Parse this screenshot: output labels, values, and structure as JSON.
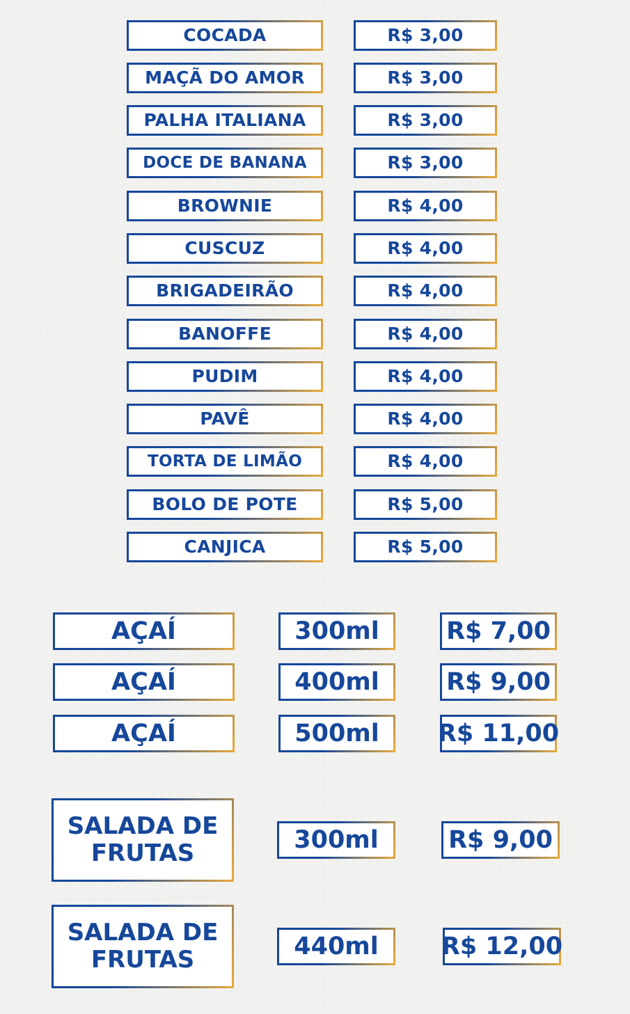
{
  "sweets": [
    {
      "name": "COCADA",
      "price": "R$ 3,00"
    },
    {
      "name": "MAÇÃ DO AMOR",
      "price": "R$ 3,00"
    },
    {
      "name": "PALHA ITALIANA",
      "price": "R$ 3,00"
    },
    {
      "name": "DOCE DE BANANA",
      "price": "R$ 3,00"
    },
    {
      "name": "BROWNIE",
      "price": "R$ 4,00"
    },
    {
      "name": "CUSCUZ",
      "price": "R$ 4,00"
    },
    {
      "name": "BRIGADEIRÃO",
      "price": "R$ 4,00"
    },
    {
      "name": "BANOFFE",
      "price": "R$ 4,00"
    },
    {
      "name": "PUDIM",
      "price": "R$ 4,00"
    },
    {
      "name": "PAVÊ",
      "price": "R$ 4,00"
    },
    {
      "name": "TORTA DE LIMÃO",
      "price": "R$ 4,00"
    },
    {
      "name": "BOLO DE POTE",
      "price": "R$ 5,00"
    },
    {
      "name": "CANJICA",
      "price": "R$ 5,00"
    }
  ],
  "acai": [
    {
      "name": "AÇAÍ",
      "size": "300ml",
      "price": "R$ 7,00"
    },
    {
      "name": "AÇAÍ",
      "size": "400ml",
      "price": "R$ 9,00"
    },
    {
      "name": "AÇAÍ",
      "size": "500ml",
      "price": "R$ 11,00"
    }
  ],
  "salada": [
    {
      "name": "SALADA DE FRUTAS",
      "size": "300ml",
      "price": "R$ 9,00"
    },
    {
      "name": "SALADA DE FRUTAS",
      "size": "440ml",
      "price": "R$ 12,00"
    }
  ],
  "colors": {
    "text": "#16479a",
    "accent": "#e7a93a",
    "background": "#f1f1ef"
  }
}
